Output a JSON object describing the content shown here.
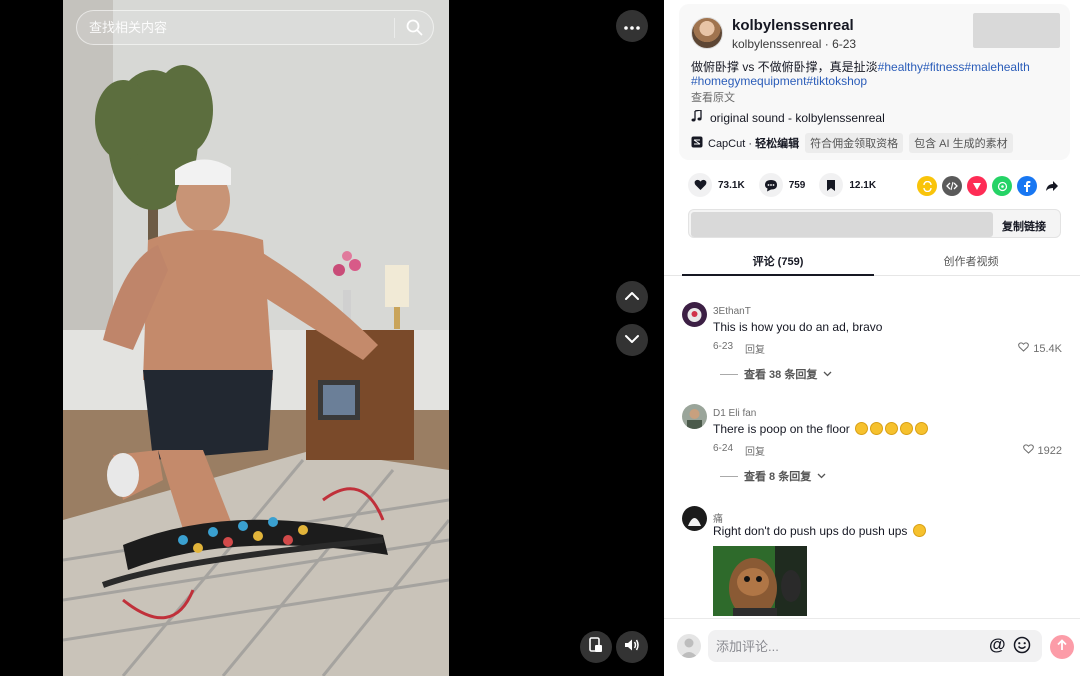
{
  "search": {
    "placeholder": "查找相关内容"
  },
  "post": {
    "author_name": "kolbylenssenreal",
    "author_handle": "kolbylenssenreal",
    "date": "6-23",
    "description_text": "做俯卧撑 vs 不做俯卧撑，真是扯淡",
    "hashtags_line1": "#healthy#fitness#malehealth",
    "hashtags_line2": "#homegymequipment#tiktokshop",
    "see_original": "查看原文",
    "music": "original sound - kolbylenssenreal",
    "capcut_prefix": "CapCut · ",
    "capcut_bold": "轻松编辑",
    "chips": [
      "符合佣金领取资格",
      "包含 AI 生成的素材"
    ]
  },
  "stats": {
    "likes": "73.1K",
    "comments": "759",
    "saves": "12.1K"
  },
  "share_icons": [
    "repost-icon",
    "embed-icon",
    "send-to-friends-icon",
    "whatsapp-icon",
    "facebook-icon",
    "share-arrow-icon"
  ],
  "link": {
    "copy_label": "复制链接"
  },
  "tabs": {
    "comments": "评论 (759)",
    "creator_videos": "创作者视频"
  },
  "comments": [
    {
      "user": "3EthanT",
      "text": "This is how you do an ad, bravo",
      "date": "6-23",
      "reply_label": "回复",
      "likes": "15.4K",
      "view_replies": "查看 38 条回复"
    },
    {
      "user": "D1 Eli fan",
      "text": "There is poop on the floor",
      "emoji_count": 5,
      "date": "6-24",
      "reply_label": "回复",
      "likes": "1922",
      "view_replies": "查看 8 条回复"
    },
    {
      "user": "痛",
      "text": "Right don't do push ups do push ups",
      "emoji_count": 1
    }
  ],
  "input": {
    "placeholder": "添加评论...",
    "at_symbol": "@"
  },
  "colors": {
    "hashtag": "#2b5db9",
    "send_button": "#fc9ca8",
    "accent": "#fe2c55"
  }
}
